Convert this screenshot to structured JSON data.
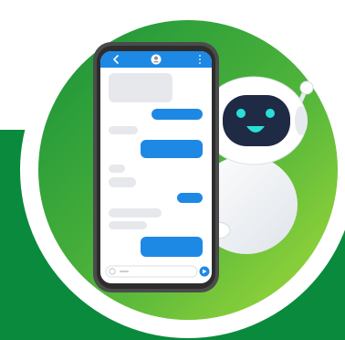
{
  "colors": {
    "backdrop_green": "#0a8a3c",
    "circle_green_dark": "#1e9a3a",
    "circle_green_light": "#9ad63a",
    "ring_white": "#ffffff",
    "phone_frame": "#4b4b4b",
    "phone_header_blue": "#1e88e5",
    "bubble_blue": "#1e88e5",
    "bubble_gray": "#e7e8ec",
    "robot_face": "#1f2a44",
    "robot_eyes": "#29e0d8",
    "robot_body": "#ffffff"
  },
  "icons": {
    "back": "chevron-left-icon",
    "avatar": "avatar-icon",
    "menu": "kebab-menu-icon",
    "send": "send-icon",
    "emoji": "emoji-icon"
  }
}
